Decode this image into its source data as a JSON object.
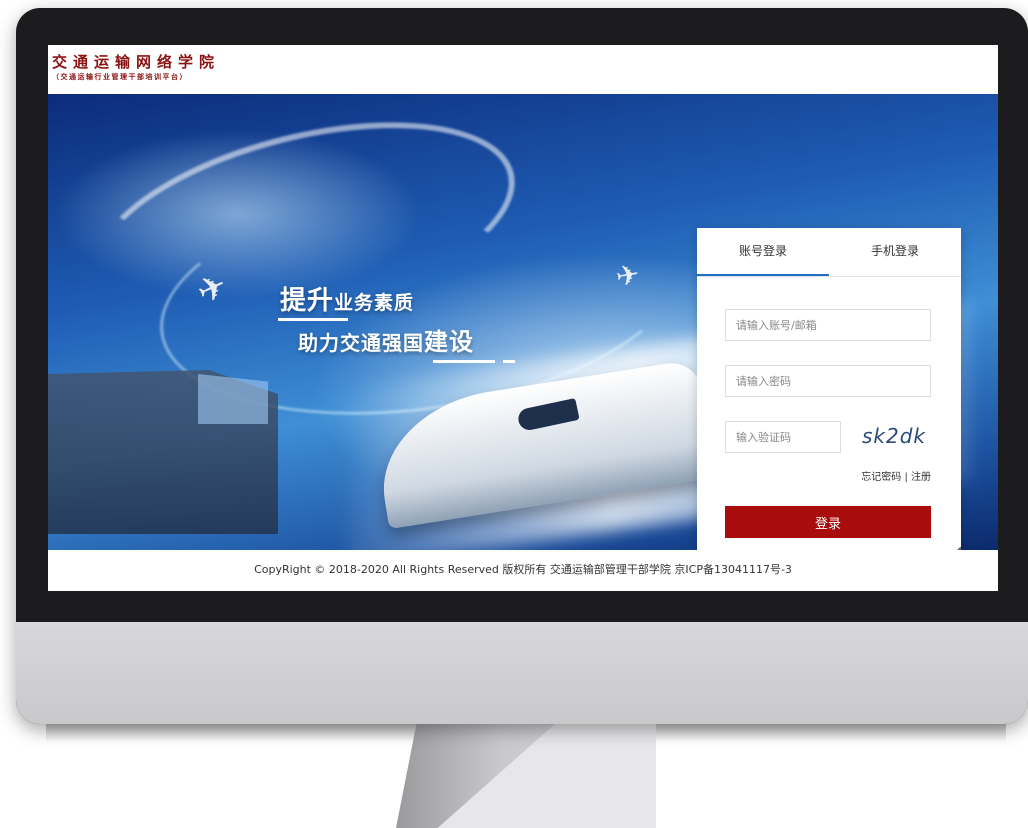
{
  "header": {
    "logo_title": "交通运输网络学院",
    "logo_subtitle": "（交通运输行业管理干部培训平台）"
  },
  "banner": {
    "slogan_line1_big": "提升",
    "slogan_line1_small": "业务素质",
    "slogan_line2_small": "助力交通强国",
    "slogan_line2_big": "建设"
  },
  "login": {
    "tabs": [
      {
        "label": "账号登录",
        "active": true
      },
      {
        "label": "手机登录",
        "active": false
      }
    ],
    "account_placeholder": "请输入账号/邮箱",
    "password_placeholder": "请输入密码",
    "captcha_placeholder": "输入验证码",
    "captcha_text": "sk2dk",
    "forgot_password": "忘记密码",
    "separator": "|",
    "register": "注册",
    "submit_label": "登录"
  },
  "footer": {
    "copyright": "CopyRight © 2018-2020 All Rights Reserved 版权所有 交通运输部管理干部学院 京ICP备13041117号-3"
  },
  "colors": {
    "brand_red": "#a80c0c",
    "tab_accent": "#1f6fc7",
    "logo_red": "#8b1212"
  }
}
